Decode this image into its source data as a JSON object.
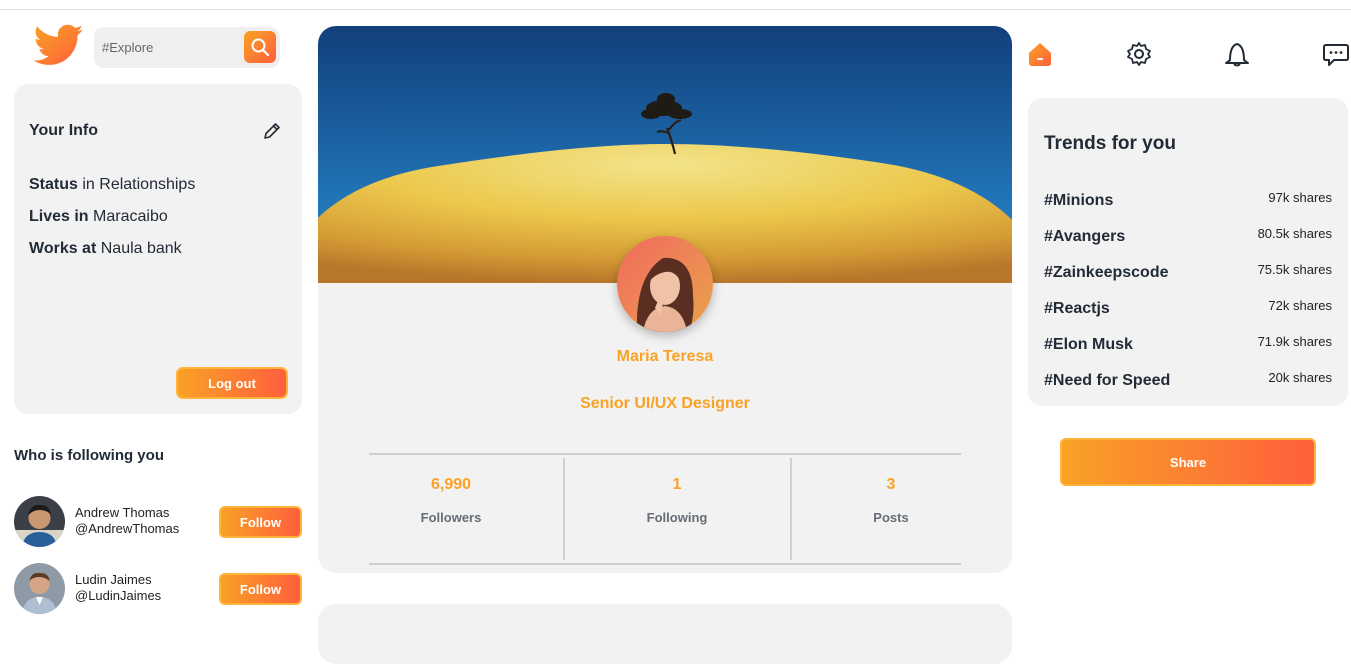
{
  "search": {
    "placeholder": "#Explore"
  },
  "info": {
    "title": "Your Info",
    "rows": [
      {
        "label": "Status",
        "value": "in Relationships"
      },
      {
        "label": "Lives in",
        "value": "Maracaibo"
      },
      {
        "label": "Works at",
        "value": "Naula bank"
      }
    ],
    "logout_label": "Log out"
  },
  "followers_section": {
    "title": "Who is following you",
    "items": [
      {
        "name": "Andrew Thomas",
        "handle": "@AndrewThomas",
        "button": "Follow"
      },
      {
        "name": "Ludin Jaimes",
        "handle": "@LudinJaimes",
        "button": "Follow"
      }
    ]
  },
  "profile": {
    "name": "Maria Teresa",
    "title": "Senior UI/UX Designer",
    "stats": [
      {
        "value": "6,990",
        "label": "Followers"
      },
      {
        "value": "1",
        "label": "Following"
      },
      {
        "value": "3",
        "label": "Posts"
      }
    ]
  },
  "nav": {
    "icons": [
      "home-icon",
      "gear-icon",
      "bell-icon",
      "chat-icon"
    ]
  },
  "trends": {
    "title": "Trends for you",
    "items": [
      {
        "tag": "#Minions",
        "count": "97k shares"
      },
      {
        "tag": "#Avangers",
        "count": "80.5k shares"
      },
      {
        "tag": "#Zainkeepscode",
        "count": "75.5k shares"
      },
      {
        "tag": "#Reactjs",
        "count": "72k shares"
      },
      {
        "tag": "#Elon Musk",
        "count": "71.9k shares"
      },
      {
        "tag": "#Need for Speed",
        "count": "20k shares"
      }
    ]
  },
  "share_label": "Share",
  "colors": {
    "accent_start": "#f9a225",
    "accent_end": "#fe5f3c",
    "card_bg": "#f2f2f2",
    "text_dark": "#222b36"
  }
}
